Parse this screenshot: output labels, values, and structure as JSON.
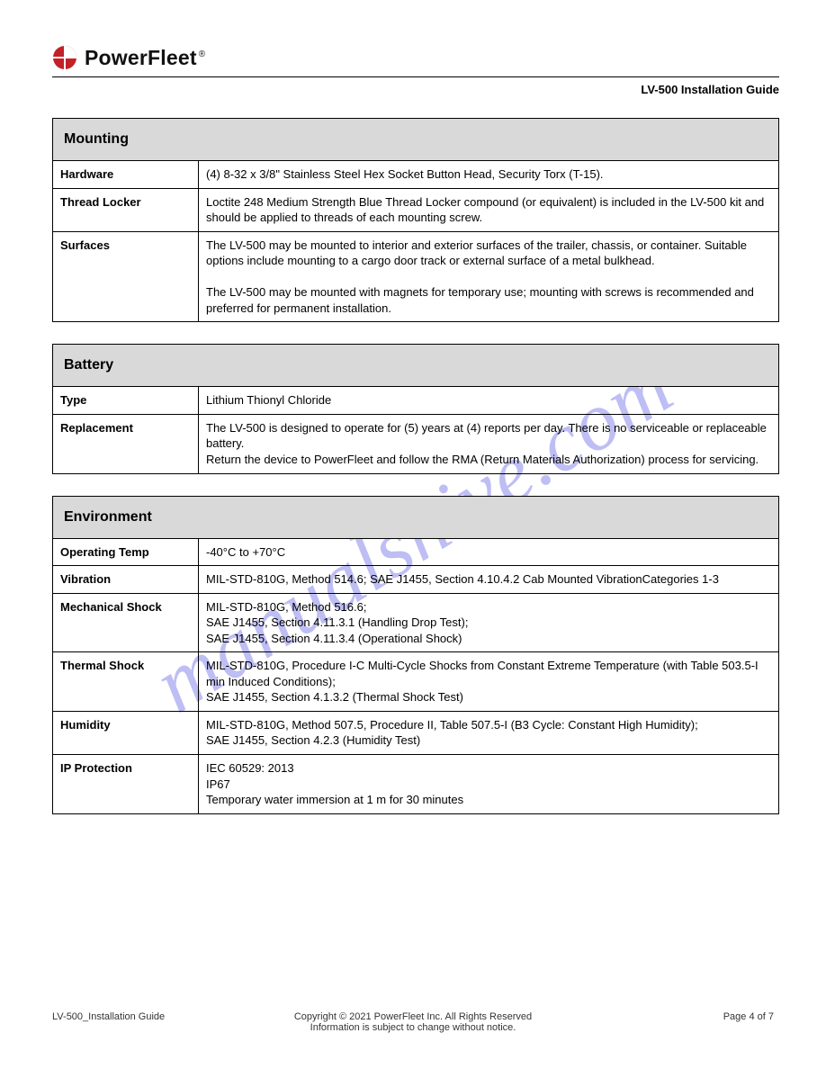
{
  "brand": {
    "name": "PowerFleet",
    "registered": "®"
  },
  "doc_title": "LV-500 Installation Guide",
  "sections": [
    {
      "title": "Mounting",
      "rows": [
        {
          "label": "Hardware",
          "value": "(4) 8-32 x 3/8\" Stainless Steel Hex Socket Button Head, Security Torx (T-15)."
        },
        {
          "label": "Thread Locker",
          "value": "Loctite 248 Medium Strength Blue Thread Locker compound (or equivalent) is included in the LV-500 kit and should be applied to threads of each mounting screw."
        },
        {
          "label": "Surfaces",
          "value": "The LV-500 may be mounted to interior and exterior surfaces of the trailer, chassis, or container. Suitable options include mounting to a cargo door track or external surface of a metal bulkhead.\n\nThe LV-500 may be mounted with magnets for temporary use; mounting with screws is recommended and preferred for permanent installation."
        }
      ]
    },
    {
      "title": "Battery",
      "rows": [
        {
          "label": "Type",
          "value": "Lithium Thionyl Chloride"
        },
        {
          "label": "Replacement",
          "value": "The LV-500 is designed to operate for (5) years at (4) reports per day. There is no serviceable or replaceable battery.\nReturn the device to PowerFleet and follow the RMA (Return Materials Authorization) process for servicing."
        }
      ]
    },
    {
      "title": "Environment",
      "rows": [
        {
          "label": "Operating Temp",
          "value": "-40°C to +70°C"
        },
        {
          "label": "Vibration",
          "value": "MIL-STD-810G, Method 514.6; SAE J1455, Section 4.10.4.2 Cab Mounted VibrationCategories 1-3"
        },
        {
          "label": "Mechanical Shock",
          "value": "MIL-STD-810G, Method 516.6;\nSAE J1455, Section 4.11.3.1 (Handling Drop Test);\nSAE J1455, Section 4.11.3.4 (Operational Shock)"
        },
        {
          "label": "Thermal Shock",
          "value": "MIL-STD-810G, Procedure I-C Multi-Cycle Shocks from Constant Extreme Temperature (with Table 503.5-I min Induced Conditions);\nSAE J1455, Section 4.1.3.2 (Thermal Shock Test)"
        },
        {
          "label": "Humidity",
          "value": "MIL-STD-810G, Method 507.5, Procedure II, Table 507.5-I (B3 Cycle: Constant High Humidity);\nSAE J1455, Section 4.2.3 (Humidity Test)"
        },
        {
          "label": "IP Protection",
          "value": "IEC 60529: 2013\nIP67\nTemporary water immersion at 1 m for 30 minutes"
        }
      ]
    }
  ],
  "footer": {
    "left": "LV-500_Installation Guide",
    "middle_line1": "Copyright © 2021 PowerFleet Inc. All Rights Reserved",
    "middle_line2": "Information is subject to change without notice.",
    "right": "Page 4 of 7"
  },
  "watermark": "manualshive.com"
}
